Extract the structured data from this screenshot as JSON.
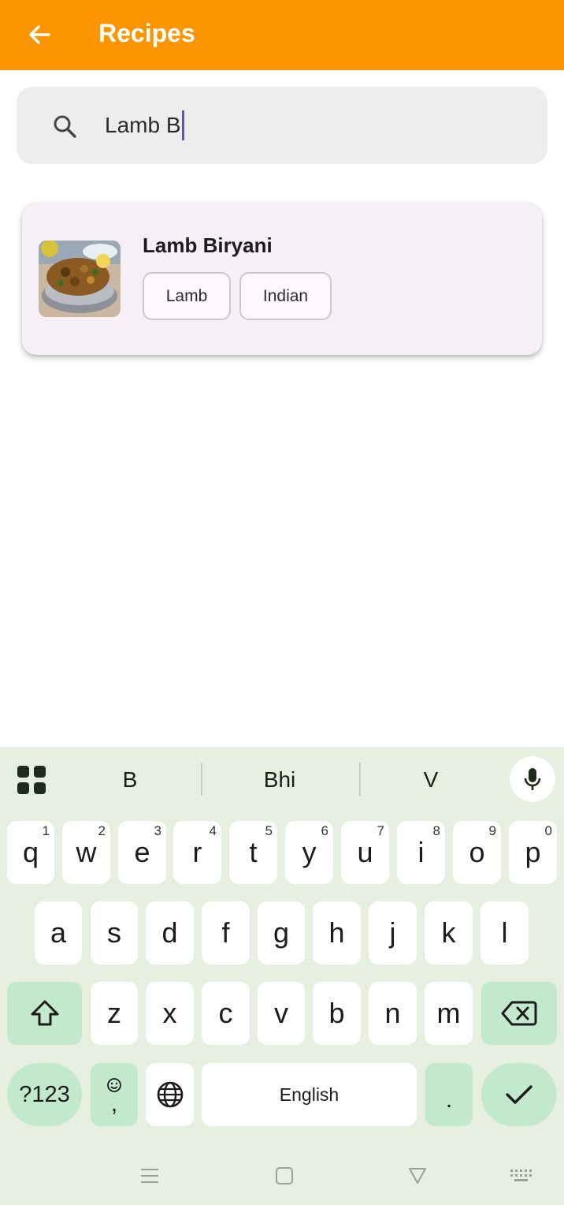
{
  "app_bar": {
    "title": "Recipes",
    "back_icon": "arrow-back-icon"
  },
  "search": {
    "value": "Lamb B",
    "icon": "search-icon"
  },
  "results": [
    {
      "title": "Lamb Biryani",
      "tags": [
        "Lamb",
        "Indian"
      ]
    }
  ],
  "keyboard": {
    "suggestions": [
      "B",
      "Bhi",
      "V"
    ],
    "row1": [
      {
        "key": "q",
        "hint": "1"
      },
      {
        "key": "w",
        "hint": "2"
      },
      {
        "key": "e",
        "hint": "3"
      },
      {
        "key": "r",
        "hint": "4"
      },
      {
        "key": "t",
        "hint": "5"
      },
      {
        "key": "y",
        "hint": "6"
      },
      {
        "key": "u",
        "hint": "7"
      },
      {
        "key": "i",
        "hint": "8"
      },
      {
        "key": "o",
        "hint": "9"
      },
      {
        "key": "p",
        "hint": "0"
      }
    ],
    "row2": [
      "a",
      "s",
      "d",
      "f",
      "g",
      "h",
      "j",
      "k",
      "l"
    ],
    "row3": [
      "z",
      "x",
      "c",
      "v",
      "b",
      "n",
      "m"
    ],
    "symbols_label": "?123",
    "comma_label": ",",
    "space_label": "English",
    "period_label": ".",
    "accent_color": "#c3e9cd"
  },
  "colors": {
    "app_bar": "#fd9500",
    "keyboard_bg": "#e7efe0"
  }
}
